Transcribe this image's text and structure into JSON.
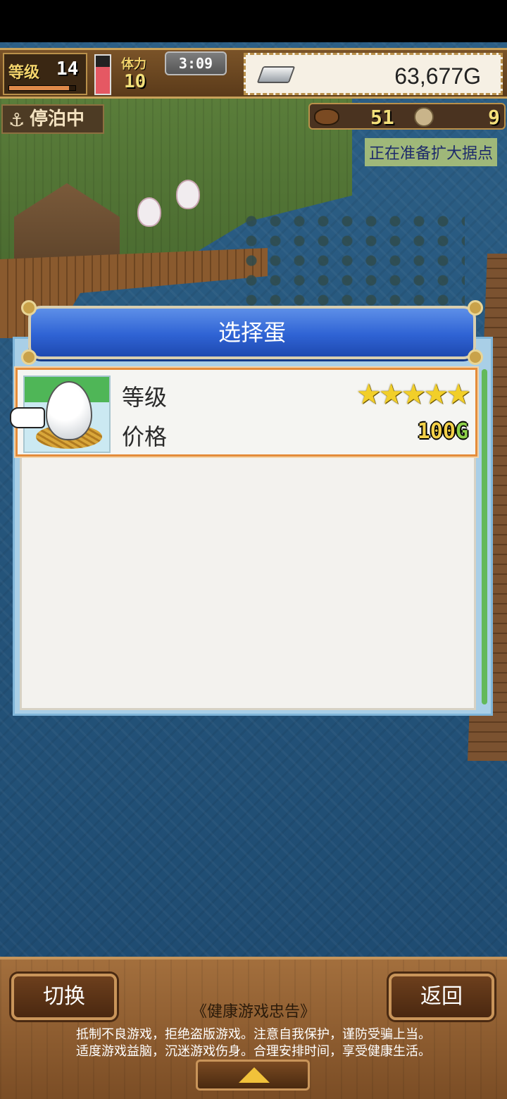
{
  "hud": {
    "level_label": "等级",
    "level_value": "14",
    "level_progress": 0.9,
    "stamina_label": "体力",
    "stamina_value": "10",
    "stamina_level": 0.7,
    "timer": "3:09",
    "gold": "63,677G"
  },
  "status": {
    "moored_label": "停泊中",
    "resource_a": "51",
    "resource_b": "9",
    "expand_notice": "正在准备扩大据点"
  },
  "dialog": {
    "title": "选择蛋",
    "items": [
      {
        "grade_label": "等级",
        "grade_stars": "★★★★★",
        "price_label": "价格",
        "price_value": "100",
        "price_unit": "G"
      }
    ]
  },
  "footer": {
    "switch_button": "切换",
    "back_button": "返回",
    "notice_title": "《健康游戏忠告》",
    "notice_line1": "抵制不良游戏，拒绝盗版游戏。注意自我保护，谨防受骗上当。",
    "notice_line2": "适度游戏益脑，沉迷游戏伤身。合理安排时间，享受健康生活。"
  },
  "colors": {
    "dialog_header": "#2f63d4",
    "selection_border": "#e48c3a",
    "star": "#f2cf29",
    "scrollbar": "#63b95a"
  }
}
